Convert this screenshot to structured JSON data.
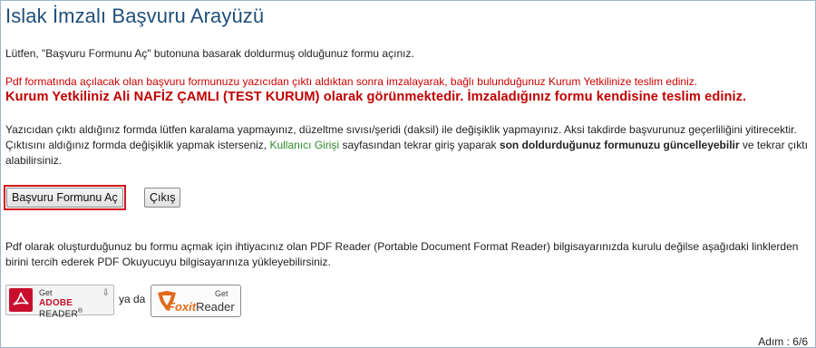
{
  "page": {
    "title": "Islak İmzalı Başvuru Arayüzü",
    "intro": "Lütfen, \"Başvuru Formunu Aç\" butonuna basarak doldurmuş olduğunuz formu açınız.",
    "warning_red": "Pdf formatında açılacak olan başvuru formunuzu yazıcıdan çıktı aldıktan sonra imzalayarak, bağlı bulunduğunuz Kurum Yetkilinize teslim ediniz.",
    "warning_bold": "Kurum Yetkiliniz Ali NAFİZ ÇAMLI (TEST KURUM) olarak görünmektedir. İmzaladığınız formu kendisine teslim ediniz.",
    "note_part1": "Yazıcıdan çıktı aldığınız formda lütfen karalama yapmayınız, düzeltme sıvısı/şeridi (daksil) ile değişiklik yapmayınız. Aksi takdirde başvurunuz geçerliliğini yitirecektir. Çıktısını aldığınız formda değişiklik yapmak isterseniz, ",
    "note_link": "Kullanıcı Girişi",
    "note_part2": " sayfasından tekrar giriş yaparak ",
    "note_bold": "son doldurduğunuz formunuzu güncelleyebilir",
    "note_part3": " ve tekrar çıktı alabilirsiniz.",
    "pdf_info": "Pdf olarak oluşturduğunuz bu formu açmak için ihtiyacınız olan PDF Reader (Portable Document Format Reader) bilgisayarınızda kurulu değilse aşağıdaki linklerden birini tercih ederek PDF Okuyucuyu bilgisayarınıza yükleyebilirsiniz.",
    "ya_da": "ya da",
    "step": "Adım : 6/6"
  },
  "buttons": {
    "open_form": "Başvuru Formunu Aç",
    "exit": "Çıkış"
  },
  "adobe": {
    "get": "Get",
    "brand": "ADOBE",
    "reader": " READER",
    "trademark": "®",
    "icon": "adobe-pdf-icon",
    "download_icon": "download-arrow-icon"
  },
  "foxit": {
    "get": "Get",
    "brand": "Foxit",
    "reader": "Reader",
    "icon": "foxit-logo-icon"
  },
  "colors": {
    "title": "#1f4e79",
    "warning": "#cc0000",
    "link": "#2f8a2f",
    "highlight_border": "#d4141e",
    "adobe_red": "#c8102e",
    "foxit_orange": "#e26a1b"
  }
}
